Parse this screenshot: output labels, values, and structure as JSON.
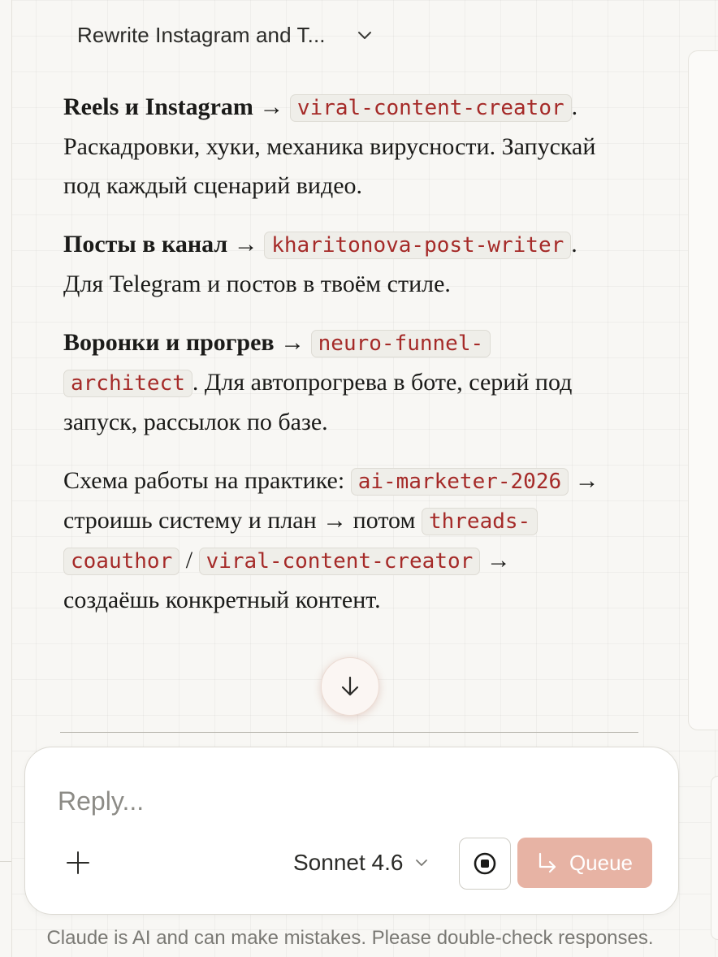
{
  "header": {
    "title": "Rewrite Instagram and T..."
  },
  "message": {
    "items": [
      {
        "heading": "Reels и Instagram",
        "arrow": "→",
        "tag": "viral-content-creator",
        "text": ". Раскадровки, хуки, механика вирусности. Запускай под каждый сценарий видео."
      },
      {
        "heading": "Посты в канал",
        "arrow": "→",
        "tag": "kharitonova-post-writer",
        "text": ". Для Telegram и постов в твоём стиле."
      },
      {
        "heading": "Воронки и прогрев",
        "arrow": "→",
        "tag": "neuro-funnel-architect",
        "text": ". Для автопрогрева в боте, серий под запуск, рассылок по базе."
      }
    ],
    "scheme": {
      "prefix": "Схема работы на практике: ",
      "tag1": "ai-marketer-2026",
      "mid": " → строишь систему и план → потом ",
      "tag2": "threads-coauthor",
      "sep": " / ",
      "tag3": "viral-content-creator",
      "suffix": " → создаёшь конкретный контент."
    }
  },
  "composer": {
    "placeholder": "Reply...",
    "model": "Sonnet 4.6",
    "queue_label": "Queue"
  },
  "disclaimer": "Claude is AI and can make mistakes. Please double-check responses.",
  "icons": [
    "chevron-down-icon",
    "arrow-down-icon",
    "plus-icon",
    "stop-icon",
    "queue-arrow-icon"
  ],
  "colors": {
    "code_text": "#a52a28",
    "queue_button": "#e7b3a4",
    "background": "#f8f7f4"
  }
}
